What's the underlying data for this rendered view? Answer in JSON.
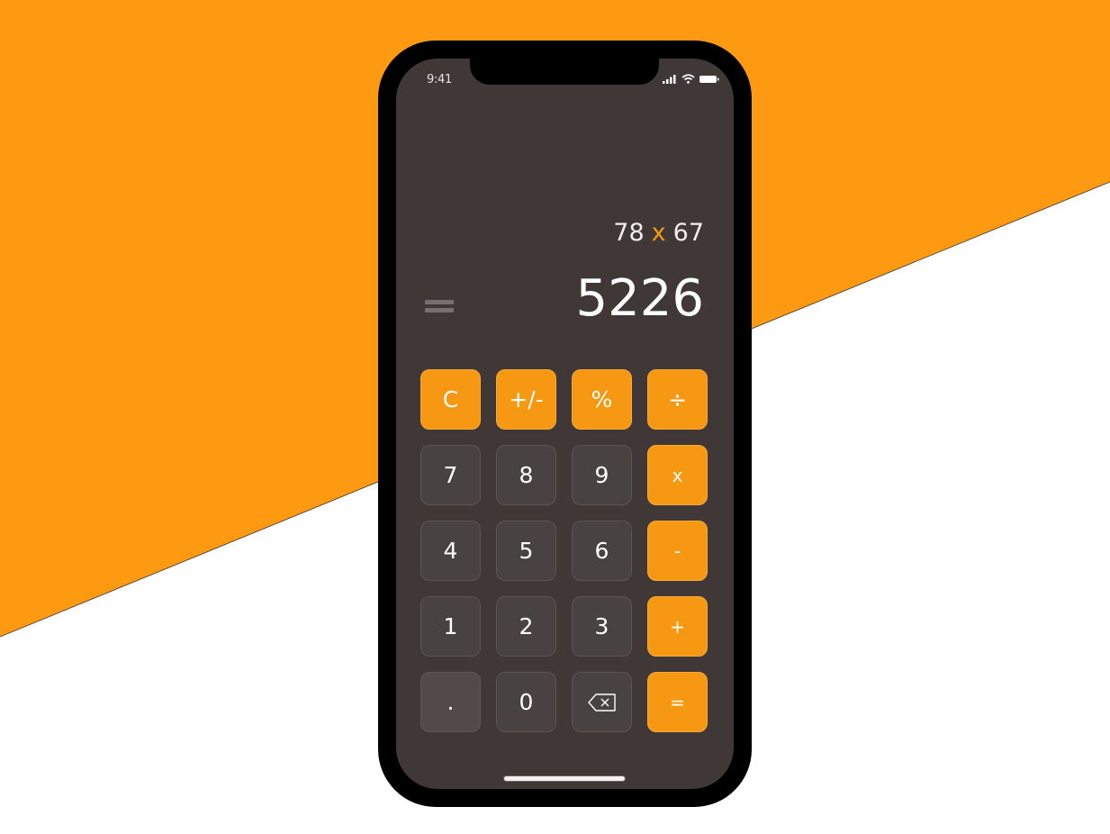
{
  "colors": {
    "accent": "#f69812",
    "screen_bg": "#403737",
    "key_dark": "#484242",
    "operator_text": "#f39b17"
  },
  "status_bar": {
    "time": "9:41",
    "icons": [
      "cellular-signal-icon",
      "wifi-icon",
      "battery-icon"
    ]
  },
  "display": {
    "operand_a": "78",
    "operator": "x",
    "operand_b": "67",
    "equals_symbol": "=",
    "result": "5226"
  },
  "keypad": {
    "clear": "C",
    "sign": "+/-",
    "percent": "%",
    "divide": "÷",
    "seven": "7",
    "eight": "8",
    "nine": "9",
    "multiply": "x",
    "four": "4",
    "five": "5",
    "six": "6",
    "minus": "-",
    "one": "1",
    "two": "2",
    "three": "3",
    "plus": "+",
    "decimal": ".",
    "zero": "0",
    "backspace_icon": "backspace-icon",
    "equals": "="
  }
}
